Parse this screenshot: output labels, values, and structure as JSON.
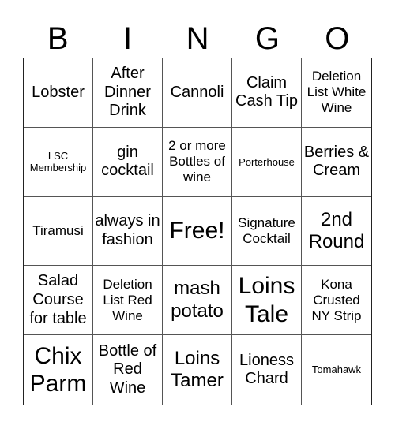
{
  "header": {
    "letters": [
      "B",
      "I",
      "N",
      "G",
      "O"
    ]
  },
  "cells": [
    [
      "Lobster",
      "After Dinner Drink",
      "Cannoli",
      "Claim Cash Tip",
      "Deletion List White Wine"
    ],
    [
      "LSC Membership",
      "gin cocktail",
      "2 or more Bottles of wine",
      "Porterhouse",
      "Berries & Cream"
    ],
    [
      "Tiramusi",
      "always in fashion",
      "Free!",
      "Signature Cocktail",
      "2nd Round"
    ],
    [
      "Salad Course for table",
      "Deletion List Red Wine",
      "mash potato",
      "Loins Tale",
      "Kona Crusted NY Strip"
    ],
    [
      "Chix Parm",
      "Bottle of Red Wine",
      "Loins Tamer",
      "Lioness Chard",
      "Tomahawk"
    ]
  ],
  "free_space": {
    "row": 2,
    "col": 2,
    "label": "Free!"
  }
}
